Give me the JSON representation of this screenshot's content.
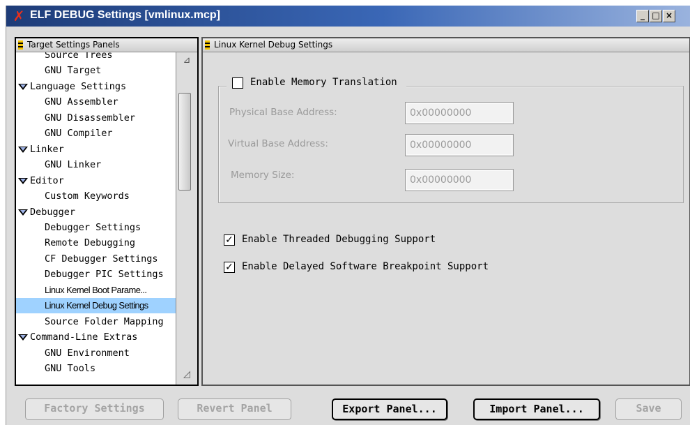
{
  "window": {
    "title": "ELF DEBUG Settings [vmlinux.mcp]",
    "icon": "x-app-icon",
    "controls": {
      "minimize": "_",
      "maximize": "□",
      "close": "×"
    }
  },
  "left_panel": {
    "header": "Target Settings Panels",
    "items": [
      {
        "label": "Source Trees",
        "level": "child"
      },
      {
        "label": "GNU Target",
        "level": "child"
      },
      {
        "label": "Language Settings",
        "level": "group"
      },
      {
        "label": "GNU Assembler",
        "level": "child"
      },
      {
        "label": "GNU Disassembler",
        "level": "child"
      },
      {
        "label": "GNU Compiler",
        "level": "child"
      },
      {
        "label": "Linker",
        "level": "group"
      },
      {
        "label": "GNU Linker",
        "level": "child"
      },
      {
        "label": "Editor",
        "level": "group"
      },
      {
        "label": "Custom Keywords",
        "level": "child"
      },
      {
        "label": "Debugger",
        "level": "group"
      },
      {
        "label": "Debugger Settings",
        "level": "child"
      },
      {
        "label": "Remote Debugging",
        "level": "child"
      },
      {
        "label": "CF Debugger Settings",
        "level": "child"
      },
      {
        "label": "Debugger PIC Settings",
        "level": "child"
      },
      {
        "label": "Linux Kernel Boot Parame...",
        "level": "child"
      },
      {
        "label": "Linux Kernel Debug Settings",
        "level": "child",
        "selected": true
      },
      {
        "label": "Source Folder Mapping",
        "level": "child"
      },
      {
        "label": "Command-Line Extras",
        "level": "group"
      },
      {
        "label": "GNU Environment",
        "level": "child"
      },
      {
        "label": "GNU Tools",
        "level": "child"
      }
    ]
  },
  "right_panel": {
    "header": "Linux Kernel Debug Settings",
    "memory_translation": {
      "label": "Enable Memory Translation",
      "checked": false,
      "fields": [
        {
          "label": "Physical Base Address:",
          "value": "0x00000000"
        },
        {
          "label": "Virtual Base Address:",
          "value": "0x00000000"
        },
        {
          "label": "Memory Size:",
          "value": "0x00000000"
        }
      ]
    },
    "threaded_debugging": {
      "label": "Enable Threaded Debugging Support",
      "checked": true
    },
    "delayed_breakpoint": {
      "label": "Enable Delayed Software Breakpoint Support",
      "checked": true
    }
  },
  "buttons": {
    "factory": "Factory Settings",
    "revert": "Revert Panel",
    "export": "Export Panel...",
    "import": "Import Panel...",
    "save": "Save"
  },
  "colors": {
    "selection": "#9fd2ff",
    "titlebar": "#1e3c78",
    "lock": "#f5c400"
  }
}
